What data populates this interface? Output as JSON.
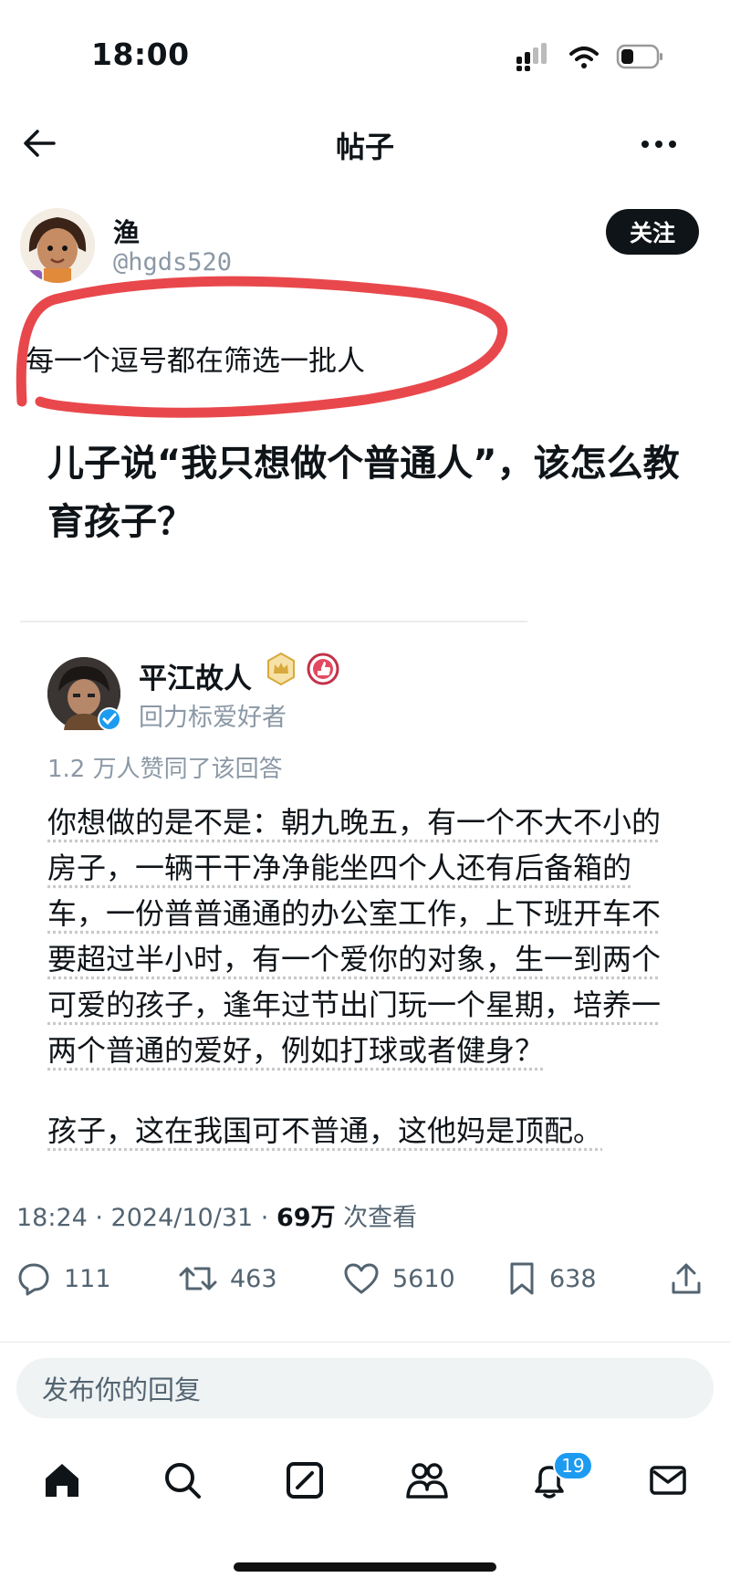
{
  "status_bar": {
    "time": "18:00"
  },
  "nav": {
    "title": "帖子"
  },
  "author": {
    "name": "渔",
    "handle": "@hgds520",
    "follow_label": "关注"
  },
  "post": {
    "text": "每一个逗号都在筛选一批人",
    "headline": "儿子说“我只想做个普通人”，该怎么教育孩子？"
  },
  "answer": {
    "author_name": "平江故人",
    "author_subtitle": "回力标爱好者",
    "likes_text": "1.2 万人赞同了该回答",
    "paragraph": "你想做的是不是：朝九晚五，有一个不大不小的房子，一辆干干净净能坐四个人还有后备箱的车，一份普普通通的办公室工作，上下班开车不要超过半小时，有一个爱你的对象，生一到两个可爱的孩子，逢年过节出门玩一个星期，培养一两个普通的爱好，例如打球或者健身？",
    "last_line": "孩子，这在我国可不普通，这他妈是顶配。"
  },
  "meta": {
    "time_date": "18:24 · 2024/10/31 · ",
    "views": "69万",
    "views_suffix": " 次查看"
  },
  "actions": {
    "replies": "111",
    "reposts": "463",
    "likes": "5610",
    "bookmarks": "638"
  },
  "reply_box": {
    "placeholder": "发布你的回复"
  },
  "tabbar": {
    "notifications_badge": "19"
  },
  "colors": {
    "annotation_red": "#e8484c",
    "accent_blue": "#1d9bf0"
  }
}
